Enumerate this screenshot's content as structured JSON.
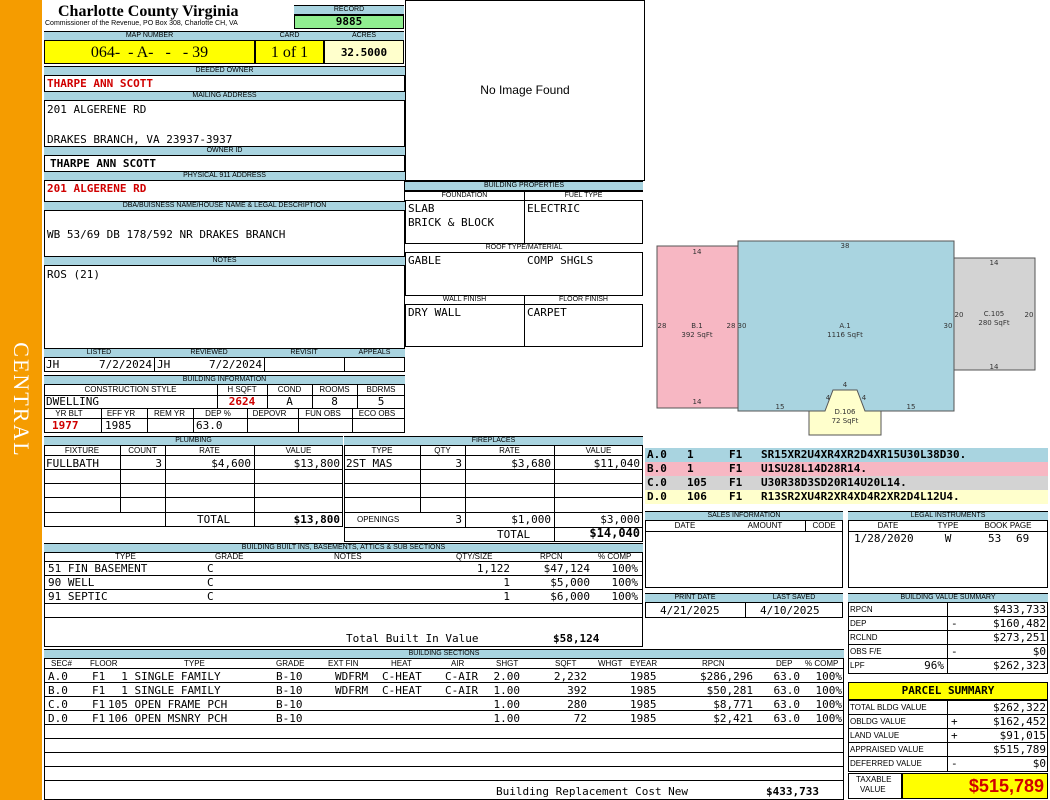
{
  "side_label": "CENTRAL",
  "header": {
    "county": "Charlotte County Virginia",
    "address": "Commissioner of the Revenue, PO Box 308, Charlotte CH, VA",
    "record_label": "RECORD",
    "record": "9885",
    "map_label": "MAP NUMBER",
    "map_number": "064-  - A-   -   - 39",
    "card_label": "CARD",
    "card": "1 of 1",
    "acres_label": "ACRES",
    "acres": "32.5000"
  },
  "owner": {
    "deeded_label": "DEEDED OWNER",
    "deeded": "THARPE ANN SCOTT",
    "mailing_label": "MAILING ADDRESS",
    "mail1": "201 ALGERENE RD",
    "mail2": "DRAKES BRANCH, VA 23937-3937",
    "ownerid_label": "OWNER ID",
    "ownerid": "THARPE ANN SCOTT",
    "phys_label": "PHYSICAL 911 ADDRESS",
    "phys": "201 ALGERENE RD",
    "dba_label": "DBA/BUISNESS NAME/HOUSE NAME & LEGAL DESCRIPTION",
    "dba": "WB 53/69 DB 178/592 NR DRAKES BRANCH",
    "notes_label": "NOTES",
    "notes": "ROS (21)"
  },
  "image": {
    "no_image": "No Image Found"
  },
  "listing": {
    "listed_label": "LISTED",
    "reviewed_label": "REVIEWED",
    "revisit_label": "REVISIT",
    "appeals_label": "APPEALS",
    "listed_by": "JH",
    "listed_date": "7/2/2024",
    "reviewed_by": "JH",
    "reviewed_date": "7/2/2024"
  },
  "building_info": {
    "label": "BUILDING INFORMATION",
    "h": [
      "CONSTRUCTION STYLE",
      "H SQFT",
      "COND",
      "ROOMS",
      "BDRMS"
    ],
    "style": "DWELLING",
    "hsqft": "2624",
    "cond": "A",
    "rooms": "8",
    "bdrms": "5",
    "h2": [
      "YR BLT",
      "EFF YR",
      "REM YR",
      "DEP %",
      "DEPOVR",
      "FUN OBS",
      "ECO OBS"
    ],
    "yrblt": "1977",
    "effyr": "1985",
    "remyr": "",
    "dep": "63.0"
  },
  "props": {
    "label": "BUILDING PROPERTIES",
    "foundation_label": "FOUNDATION",
    "fuel_label": "FUEL TYPE",
    "foundation1": "SLAB",
    "foundation2": "BRICK & BLOCK",
    "fuel": "ELECTRIC",
    "roof_label": "ROOF TYPE/MATERIAL",
    "roof1": "GABLE",
    "roof2": "COMP SHGLS",
    "wall_label": "WALL FINISH",
    "floor_label": "FLOOR FINISH",
    "wall": "DRY WALL",
    "floor": "CARPET"
  },
  "sketch": {
    "sections": [
      {
        "id": "B.1",
        "area": "392 SqFt"
      },
      {
        "id": "A.1",
        "area": "1116 SqFt"
      },
      {
        "id": "C.105",
        "area": "280 SqFt"
      },
      {
        "id": "D.106",
        "area": "72 SqFt"
      }
    ],
    "dims": [
      "14",
      "28",
      "28",
      "14",
      "38",
      "30",
      "30",
      "15",
      "15",
      "4",
      "4",
      "4",
      "14",
      "20",
      "20",
      "14"
    ],
    "codes": [
      {
        "sec": "A.0",
        "n": "1",
        "f": "F1",
        "code": "SR15XR2U4XR4XR2D4XR15U30L38D30.",
        "color": "#a9d4e0"
      },
      {
        "sec": "B.0",
        "n": "1",
        "f": "F1",
        "code": "U1SU28L14D28R14.",
        "color": "#f7b7c3"
      },
      {
        "sec": "C.0",
        "n": "105",
        "f": "F1",
        "code": "U30R38D3SD20R14U20L14.",
        "color": "#d3d3d3"
      },
      {
        "sec": "D.0",
        "n": "106",
        "f": "F1",
        "code": "R13SR2XU4R2XR4XD4R2XR2D4L12U4.",
        "color": "#ffffcc"
      }
    ]
  },
  "plumbing": {
    "label": "PLUMBING",
    "h": [
      "FIXTURE",
      "COUNT",
      "RATE",
      "VALUE"
    ],
    "rows": [
      {
        "fixture": "FULLBATH",
        "count": "3",
        "rate": "$4,600",
        "value": "$13,800"
      }
    ],
    "total_label": "TOTAL",
    "total": "$13,800"
  },
  "fireplaces": {
    "label": "FIREPLACES",
    "h": [
      "TYPE",
      "QTY",
      "RATE",
      "VALUE"
    ],
    "rows": [
      {
        "type": "2ST MAS",
        "qty": "3",
        "rate": "$3,680",
        "value": "$11,040"
      }
    ],
    "openings_label": "OPENINGS",
    "openings_qty": "3",
    "openings_rate": "$1,000",
    "openings_value": "$3,000",
    "total_label": "TOTAL",
    "total": "$14,040"
  },
  "sales": {
    "label": "SALES INFORMATION",
    "h": [
      "DATE",
      "AMOUNT",
      "CODE"
    ]
  },
  "legal": {
    "label": "LEGAL INSTRUMENTS",
    "h": [
      "DATE",
      "TYPE",
      "BOOK PAGE"
    ],
    "date": "1/28/2020",
    "type": "W",
    "book": "53",
    "page": "69"
  },
  "builtins": {
    "label": "BUILDING BUILT INS, BASEMENTS, ATTICS & SUB SECTIONS",
    "h": [
      "TYPE",
      "GRADE",
      "NOTES",
      "QTY/SIZE",
      "RPCN",
      "% COMP"
    ],
    "rows": [
      {
        "type": "51 FIN BASEMENT",
        "grade": "C",
        "qty": "1,122",
        "rpcn": "$47,124",
        "comp": "100%"
      },
      {
        "type": "90 WELL",
        "grade": "C",
        "qty": "1",
        "rpcn": "$5,000",
        "comp": "100%"
      },
      {
        "type": "91 SEPTIC",
        "grade": "C",
        "qty": "1",
        "rpcn": "$6,000",
        "comp": "100%"
      }
    ],
    "total_label": "Total Built In Value",
    "total": "$58,124"
  },
  "dates": {
    "print_label": "PRINT DATE",
    "saved_label": "LAST SAVED",
    "print": "4/21/2025",
    "saved": "4/10/2025"
  },
  "value_summary": {
    "label": "BUILDING VALUE SUMMARY",
    "rows": [
      {
        "k": "RPCN",
        "s": "",
        "v": "$433,733"
      },
      {
        "k": "DEP",
        "s": "-",
        "v": "$160,482"
      },
      {
        "k": "RCLND",
        "s": "",
        "v": "$273,251"
      },
      {
        "k": "OBS F/E",
        "s": "-",
        "v": "$0"
      },
      {
        "k": "LPF",
        "p": "96%",
        "s": "",
        "v": "$262,323"
      }
    ]
  },
  "sections": {
    "label": "BUILDING SECTIONS",
    "h": [
      "SEC#",
      "FLOOR",
      "TYPE",
      "GRADE",
      "EXT FIN",
      "HEAT",
      "AIR",
      "SHGT",
      "SQFT",
      "WHGT",
      "EYEAR",
      "RPCN",
      "DEP",
      "% COMP"
    ],
    "rows": [
      {
        "sec": "A.0",
        "floor": "F1",
        "type": "  1 SINGLE FAMILY",
        "grade": "B-10",
        "ext": "WDFRM",
        "heat": "C-HEAT",
        "air": "C-AIR",
        "shgt": "2.00",
        "sqft": "2,232",
        "whgt": "",
        "eyear": "1985",
        "rpcn": "$286,296",
        "dep": "63.0",
        "comp": "100%"
      },
      {
        "sec": "B.0",
        "floor": "F1",
        "type": "  1 SINGLE FAMILY",
        "grade": "B-10",
        "ext": "WDFRM",
        "heat": "C-HEAT",
        "air": "C-AIR",
        "shgt": "1.00",
        "sqft": "392",
        "whgt": "",
        "eyear": "1985",
        "rpcn": "$50,281",
        "dep": "63.0",
        "comp": "100%"
      },
      {
        "sec": "C.0",
        "floor": "F1",
        "type": "105 OPEN FRAME PCH",
        "grade": "B-10",
        "ext": "",
        "heat": "",
        "air": "",
        "shgt": "1.00",
        "sqft": "280",
        "whgt": "",
        "eyear": "1985",
        "rpcn": "$8,771",
        "dep": "63.0",
        "comp": "100%"
      },
      {
        "sec": "D.0",
        "floor": "F1",
        "type": "106 OPEN MSNRY PCH",
        "grade": "B-10",
        "ext": "",
        "heat": "",
        "air": "",
        "shgt": "1.00",
        "sqft": "72",
        "whgt": "",
        "eyear": "1985",
        "rpcn": "$2,421",
        "dep": "63.0",
        "comp": "100%"
      }
    ],
    "brcn_label": "Building Replacement Cost New",
    "brcn": "$433,733"
  },
  "parcel": {
    "label": "PARCEL SUMMARY",
    "rows": [
      {
        "k": "TOTAL BLDG VALUE",
        "s": "",
        "v": "$262,322"
      },
      {
        "k": "OBLDG VALUE",
        "s": "+",
        "v": "$162,452"
      },
      {
        "k": "LAND VALUE",
        "s": "+",
        "v": "$91,015"
      },
      {
        "k": "APPRAISED VALUE",
        "s": "",
        "v": "$515,789"
      },
      {
        "k": "DEFERRED VALUE",
        "s": "-",
        "v": "$0"
      }
    ],
    "taxable_label1": "TAXABLE",
    "taxable_label2": "VALUE",
    "taxable": "$515,789"
  }
}
